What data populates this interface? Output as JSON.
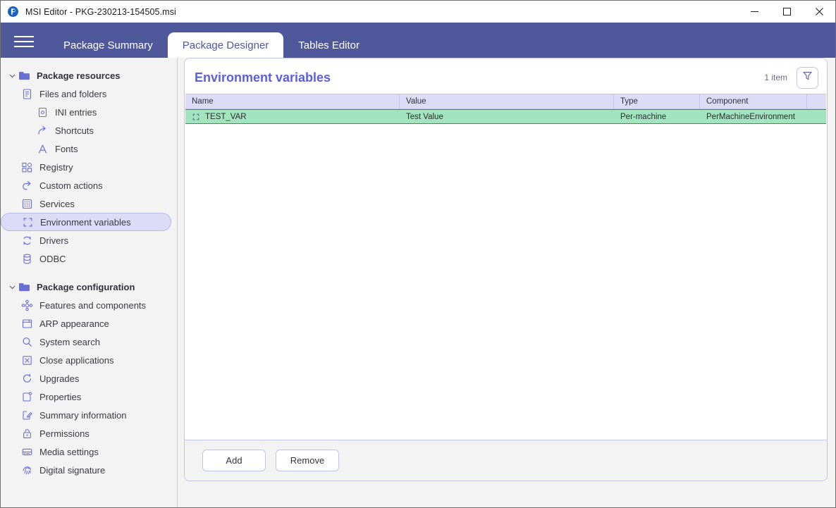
{
  "window": {
    "title": "MSI Editor - PKG-230213-154505.msi",
    "app_icon": "msi-editor-logo",
    "minimize_label": "minimize-icon",
    "maximize_label": "maximize-icon",
    "close_label": "close-icon"
  },
  "tabbar": {
    "menu_icon": "hamburger-menu-icon",
    "tabs": [
      {
        "label": "Package Summary",
        "active": false
      },
      {
        "label": "Package Designer",
        "active": true
      },
      {
        "label": "Tables Editor",
        "active": false
      }
    ]
  },
  "sidebar": {
    "groups": [
      {
        "label": "Package resources",
        "icon": "folder-icon",
        "expanded": true,
        "chevron": "chevron-down-icon",
        "items": [
          {
            "label": "Files and folders",
            "icon": "document-icon",
            "level": 1,
            "selected": false
          },
          {
            "label": "INI entries",
            "icon": "ini-file-icon",
            "level": 2,
            "selected": false
          },
          {
            "label": "Shortcuts",
            "icon": "shortcut-arrow-icon",
            "level": 2,
            "selected": false
          },
          {
            "label": "Fonts",
            "icon": "font-letter-a-icon",
            "level": 2,
            "selected": false
          },
          {
            "label": "Registry",
            "icon": "registry-blocks-icon",
            "level": 1,
            "selected": false
          },
          {
            "label": "Custom actions",
            "icon": "custom-action-arrow-icon",
            "level": 1,
            "selected": false
          },
          {
            "label": "Services",
            "icon": "services-grid-icon",
            "level": 1,
            "selected": false
          },
          {
            "label": "Environment variables",
            "icon": "environment-brackets-icon",
            "level": 1,
            "selected": true
          },
          {
            "label": "Drivers",
            "icon": "drivers-refresh-icon",
            "level": 1,
            "selected": false
          },
          {
            "label": "ODBC",
            "icon": "database-icon",
            "level": 1,
            "selected": false
          }
        ]
      },
      {
        "label": "Package configuration",
        "icon": "folder-icon",
        "expanded": true,
        "chevron": "chevron-down-icon",
        "items": [
          {
            "label": "Features and components",
            "icon": "features-nodes-icon",
            "level": 1,
            "selected": false
          },
          {
            "label": "ARP appearance",
            "icon": "window-icon",
            "level": 1,
            "selected": false
          },
          {
            "label": "System search",
            "icon": "search-icon",
            "level": 1,
            "selected": false
          },
          {
            "label": "Close applications",
            "icon": "close-box-icon",
            "level": 1,
            "selected": false
          },
          {
            "label": "Upgrades",
            "icon": "upgrade-refresh-icon",
            "level": 1,
            "selected": false
          },
          {
            "label": "Properties",
            "icon": "properties-icon",
            "level": 1,
            "selected": false
          },
          {
            "label": "Summary information",
            "icon": "edit-note-icon",
            "level": 1,
            "selected": false
          },
          {
            "label": "Permissions",
            "icon": "lock-icon",
            "level": 1,
            "selected": false
          },
          {
            "label": "Media settings",
            "icon": "media-disk-icon",
            "level": 1,
            "selected": false
          },
          {
            "label": "Digital signature",
            "icon": "fingerprint-icon",
            "level": 1,
            "selected": false
          }
        ]
      }
    ]
  },
  "main": {
    "title": "Environment variables",
    "item_count": "1 item",
    "filter_icon": "filter-funnel-icon",
    "table": {
      "columns": [
        "Name",
        "Value",
        "Type",
        "Component"
      ],
      "rows": [
        {
          "icon": "environment-brackets-icon",
          "name": "TEST_VAR",
          "value": "Test Value",
          "type": "Per-machine",
          "component": "PerMachineEnvironment",
          "selected": true
        }
      ]
    },
    "buttons": {
      "add": "Add",
      "remove": "Remove"
    }
  },
  "colors": {
    "accent": "#50589c",
    "title_accent": "#5b5fde",
    "icon": "#6a6fd4",
    "selection_row": "#a2e4be",
    "header_row": "#dcdcf7",
    "border": "#c3c5e6"
  }
}
